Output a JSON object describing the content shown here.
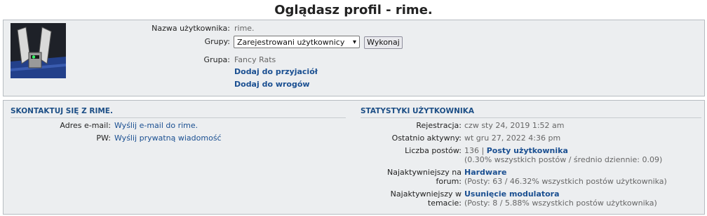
{
  "page": {
    "title": "Oglądasz profil - rime."
  },
  "profile": {
    "username_label": "Nazwa użytkownika:",
    "username": "rime.",
    "groups_label": "Grupy:",
    "groups_selected": "Zarejestrowani użytkownicy",
    "groups_button": "Wykonaj",
    "group_label": "Grupa:",
    "group_value": "Fancy Rats",
    "add_friend": "Dodaj do przyjaciół",
    "add_foe": "Dodaj do wrogów"
  },
  "contact": {
    "heading": "SKONTAKTUJ SIĘ Z RIME.",
    "email_label": "Adres e-mail:",
    "email_link": "Wyślij e-mail do rime.",
    "pm_label": "PW:",
    "pm_link": "Wyślij prywatną wiadomość"
  },
  "stats": {
    "heading": "STATYSTYKI UŻYTKOWNIKA",
    "registered_label": "Rejestracja:",
    "registered": "czw sty 24, 2019 1:52 am",
    "last_active_label": "Ostatnio aktywny:",
    "last_active": "wt gru 27, 2022 4:36 pm",
    "posts_label": "Liczba postów:",
    "posts_count": "136 |",
    "posts_link": "Posty użytkownika",
    "posts_detail": "(0.30% wszystkich postów / średnio dziennie: 0.09)",
    "forum_label_1": "Najaktywniejszy na",
    "forum_label_2": "forum:",
    "forum_link": "Hardware",
    "forum_detail": "(Posty: 63 / 46.32% wszystkich postów użytkownika)",
    "topic_label_1": "Najaktywniejszy w",
    "topic_label_2": "temacie:",
    "topic_link": "Usunięcie modulatora",
    "topic_detail": "(Posty: 8 / 5.88% wszystkich postów użytkownika)"
  }
}
